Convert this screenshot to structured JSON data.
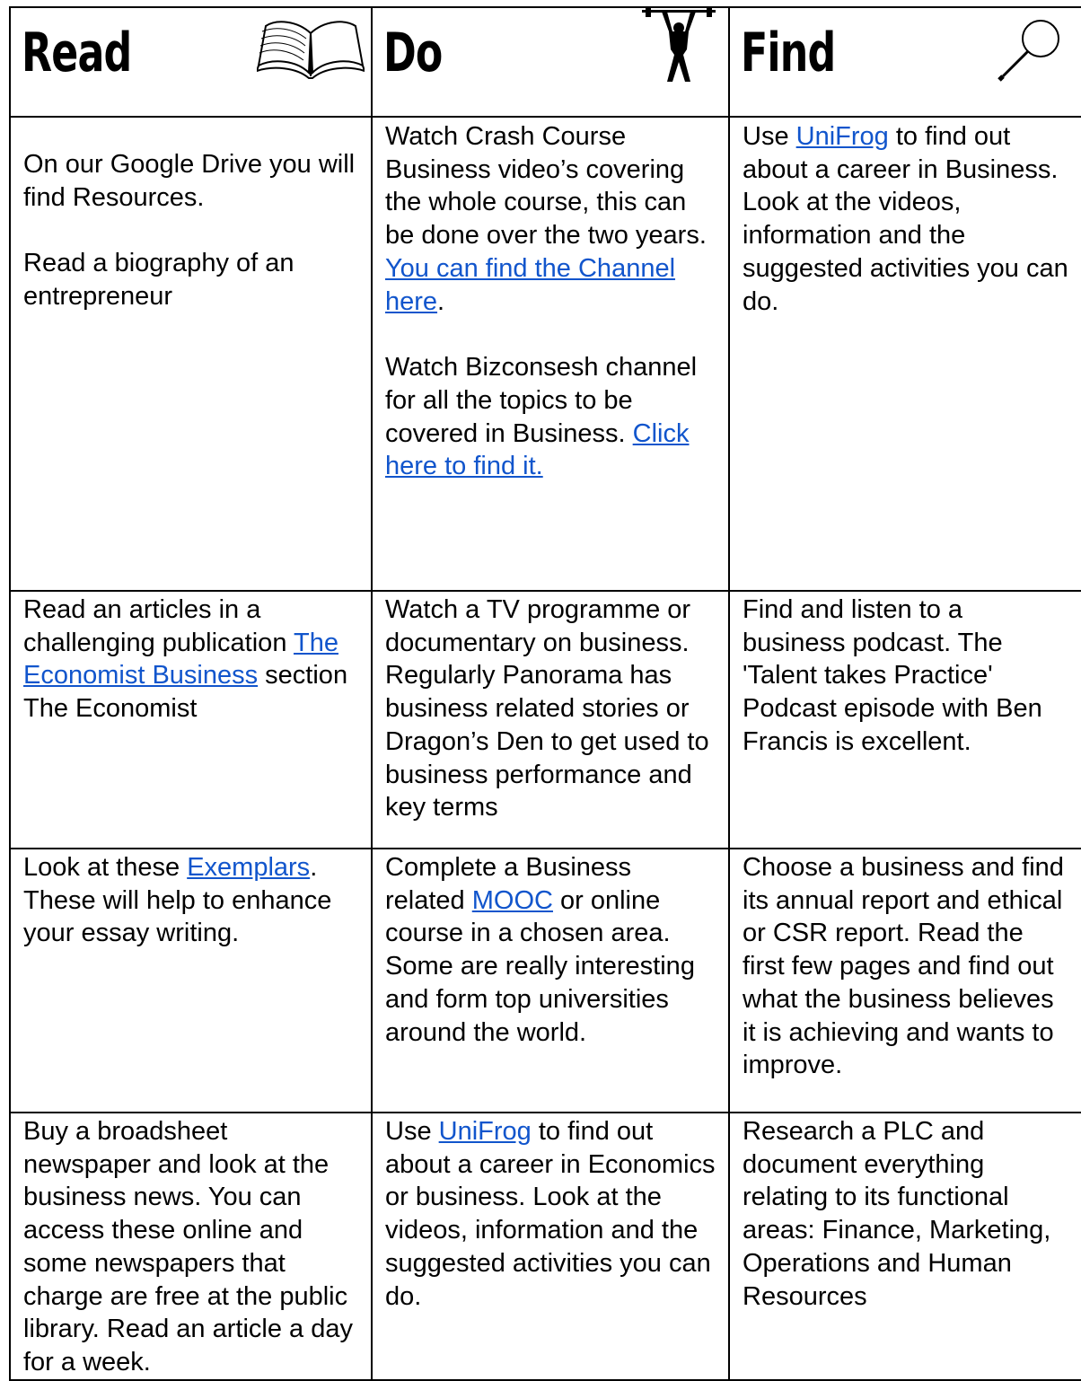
{
  "header": {
    "read": "Read",
    "do": "Do",
    "find": "Find"
  },
  "icons": {
    "read": "open-book-icon",
    "do": "weightlifter-icon",
    "find": "magnifying-glass-icon"
  },
  "rows": [
    {
      "read": {
        "p1": "On our Google Drive you will find Resources.",
        "p2": "Read a biography of an entrepreneur"
      },
      "do": {
        "p1_text": "Watch Crash Course Business video’s covering the whole course, this can be done over the two years.  ",
        "p1_link": "You can find the Channel here",
        "p1_end": ".",
        "p2_text": "Watch Bizconsesh channel for all the topics to be covered in Business.  ",
        "p2_link": "Click here to find it."
      },
      "find": {
        "pre": "Use ",
        "link": "UniFrog",
        "post": " to find out about a career in Business. Look at the videos, information and the suggested activities you can do."
      }
    },
    {
      "read": {
        "pre": "Read an articles in a challenging publication ",
        "link": "The Economist Business",
        "post": " section The Economist"
      },
      "do": {
        "text": "Watch a TV programme or documentary on business. Regularly Panorama has business related stories or Dragon’s Den to get used to business performance and key terms"
      },
      "find": {
        "text": "Find and listen to a business podcast. The 'Talent takes Practice' Podcast episode with Ben Francis is excellent."
      }
    },
    {
      "read": {
        "pre": "Look at these ",
        "link": "Exemplars",
        "post": ". These will help to enhance your essay writing."
      },
      "do": {
        "pre": "Complete a Business related ",
        "link": "MOOC",
        "post": " or online course in a chosen area. Some are really interesting and form top universities around the world."
      },
      "find": {
        "text": "Choose a business and find its annual report and ethical or CSR report. Read the first few pages and find out what the business believes it is achieving and wants to improve."
      }
    },
    {
      "read": {
        "text": "Buy a broadsheet newspaper and look at the business news. You can access these online and some newspapers that charge are free at the public library. Read an article a day for a week."
      },
      "do": {
        "pre": "Use ",
        "link": "UniFrog",
        "post": " to find out about a career in Economics or business. Look at the videos, information and the suggested activities you can do."
      },
      "find": {
        "text": "Research a PLC and document everything relating to its functional areas: Finance, Marketing, Operations and Human Resources"
      }
    }
  ]
}
